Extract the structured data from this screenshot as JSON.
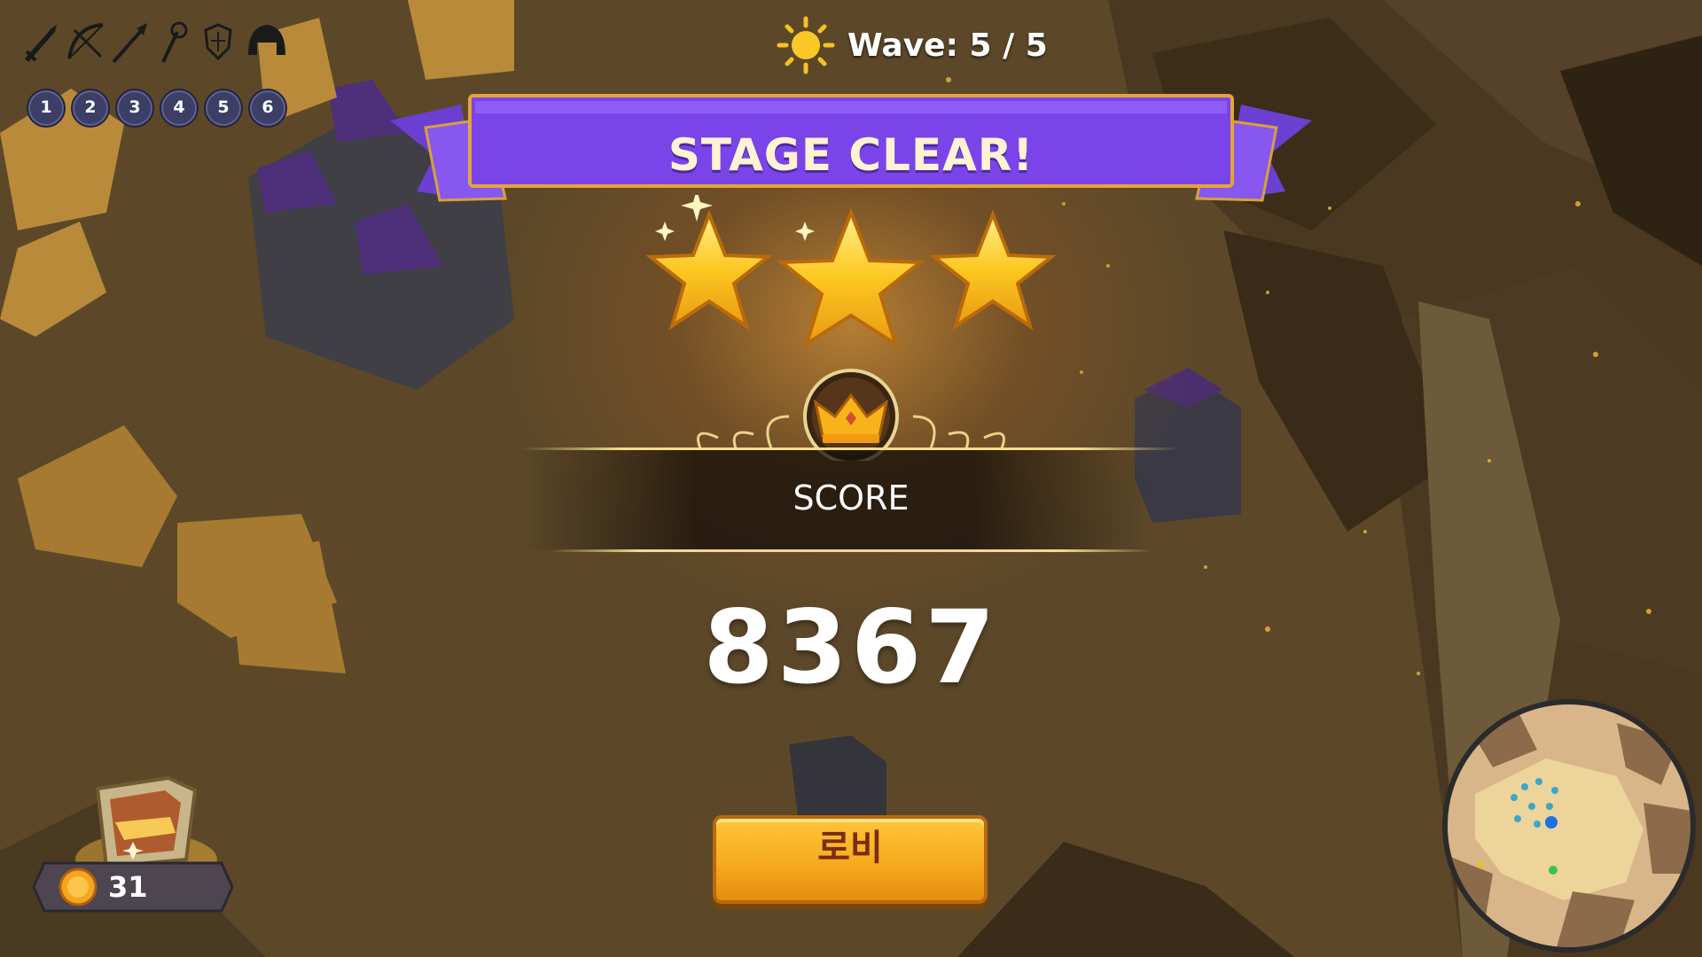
{
  "hud": {
    "tool_numbers": [
      "1",
      "2",
      "3",
      "4",
      "5",
      "6"
    ],
    "tool_icons": [
      "sword-icon",
      "bow-icon",
      "spear-icon",
      "staff-icon",
      "shield-icon",
      "helmet-icon"
    ],
    "wave_icon": "sun-icon",
    "wave_text": "Wave: 5 / 5"
  },
  "result": {
    "banner_title": "STAGE CLEAR!",
    "stars_earned": 3,
    "stars_total": 3,
    "score_label": "SCORE",
    "score_value": "8367"
  },
  "lobby_button": {
    "label": "로비"
  },
  "wallet": {
    "coin_icon": "coin-icon",
    "count": "31"
  },
  "colors": {
    "banner_purple": "#7a44e8",
    "gold": "#f5b91c",
    "background": "#5e4a2c"
  }
}
